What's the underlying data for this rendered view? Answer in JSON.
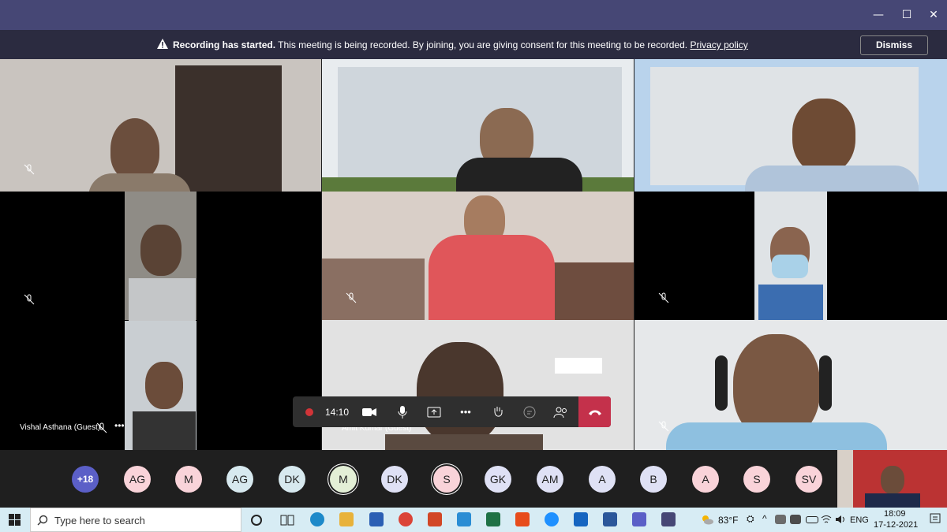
{
  "banner": {
    "bold": "Recording has started.",
    "text": " This meeting is being recorded. By joining, you are giving consent for this meeting to be recorded.",
    "link": "Privacy policy",
    "dismiss": "Dismiss"
  },
  "window_controls": {
    "minimize": "—",
    "maximize": "☐",
    "close": "✕"
  },
  "participants": {
    "vishal": "Vishal Asthana (Guest)",
    "amit": "Amit Kumar (Guest)"
  },
  "controls": {
    "timer": "14:10",
    "more": "•••"
  },
  "avatars": [
    {
      "initials": "+18",
      "color": "#5b5fc7"
    },
    {
      "initials": "AG",
      "color": "#f9d3d9"
    },
    {
      "initials": "M",
      "color": "#f9d3d9"
    },
    {
      "initials": "AG",
      "color": "#d7e9ef"
    },
    {
      "initials": "DK",
      "color": "#d7e9ef"
    },
    {
      "initials": "M",
      "color": "#e3efd6"
    },
    {
      "initials": "DK",
      "color": "#dfe1f5"
    },
    {
      "initials": "S",
      "color": "#f9d3d9"
    },
    {
      "initials": "GK",
      "color": "#dfe1f5"
    },
    {
      "initials": "AM",
      "color": "#dfe1f5"
    },
    {
      "initials": "A",
      "color": "#dfe1f5"
    },
    {
      "initials": "B",
      "color": "#dfe1f5"
    },
    {
      "initials": "A",
      "color": "#f9d3d9"
    },
    {
      "initials": "S",
      "color": "#f9d3d9"
    },
    {
      "initials": "SV",
      "color": "#f9d3d9"
    }
  ],
  "taskbar": {
    "search_placeholder": "Type here to search",
    "weather": "83°F",
    "lang": "ENG",
    "time": "18:09",
    "date": "17-12-2021"
  }
}
